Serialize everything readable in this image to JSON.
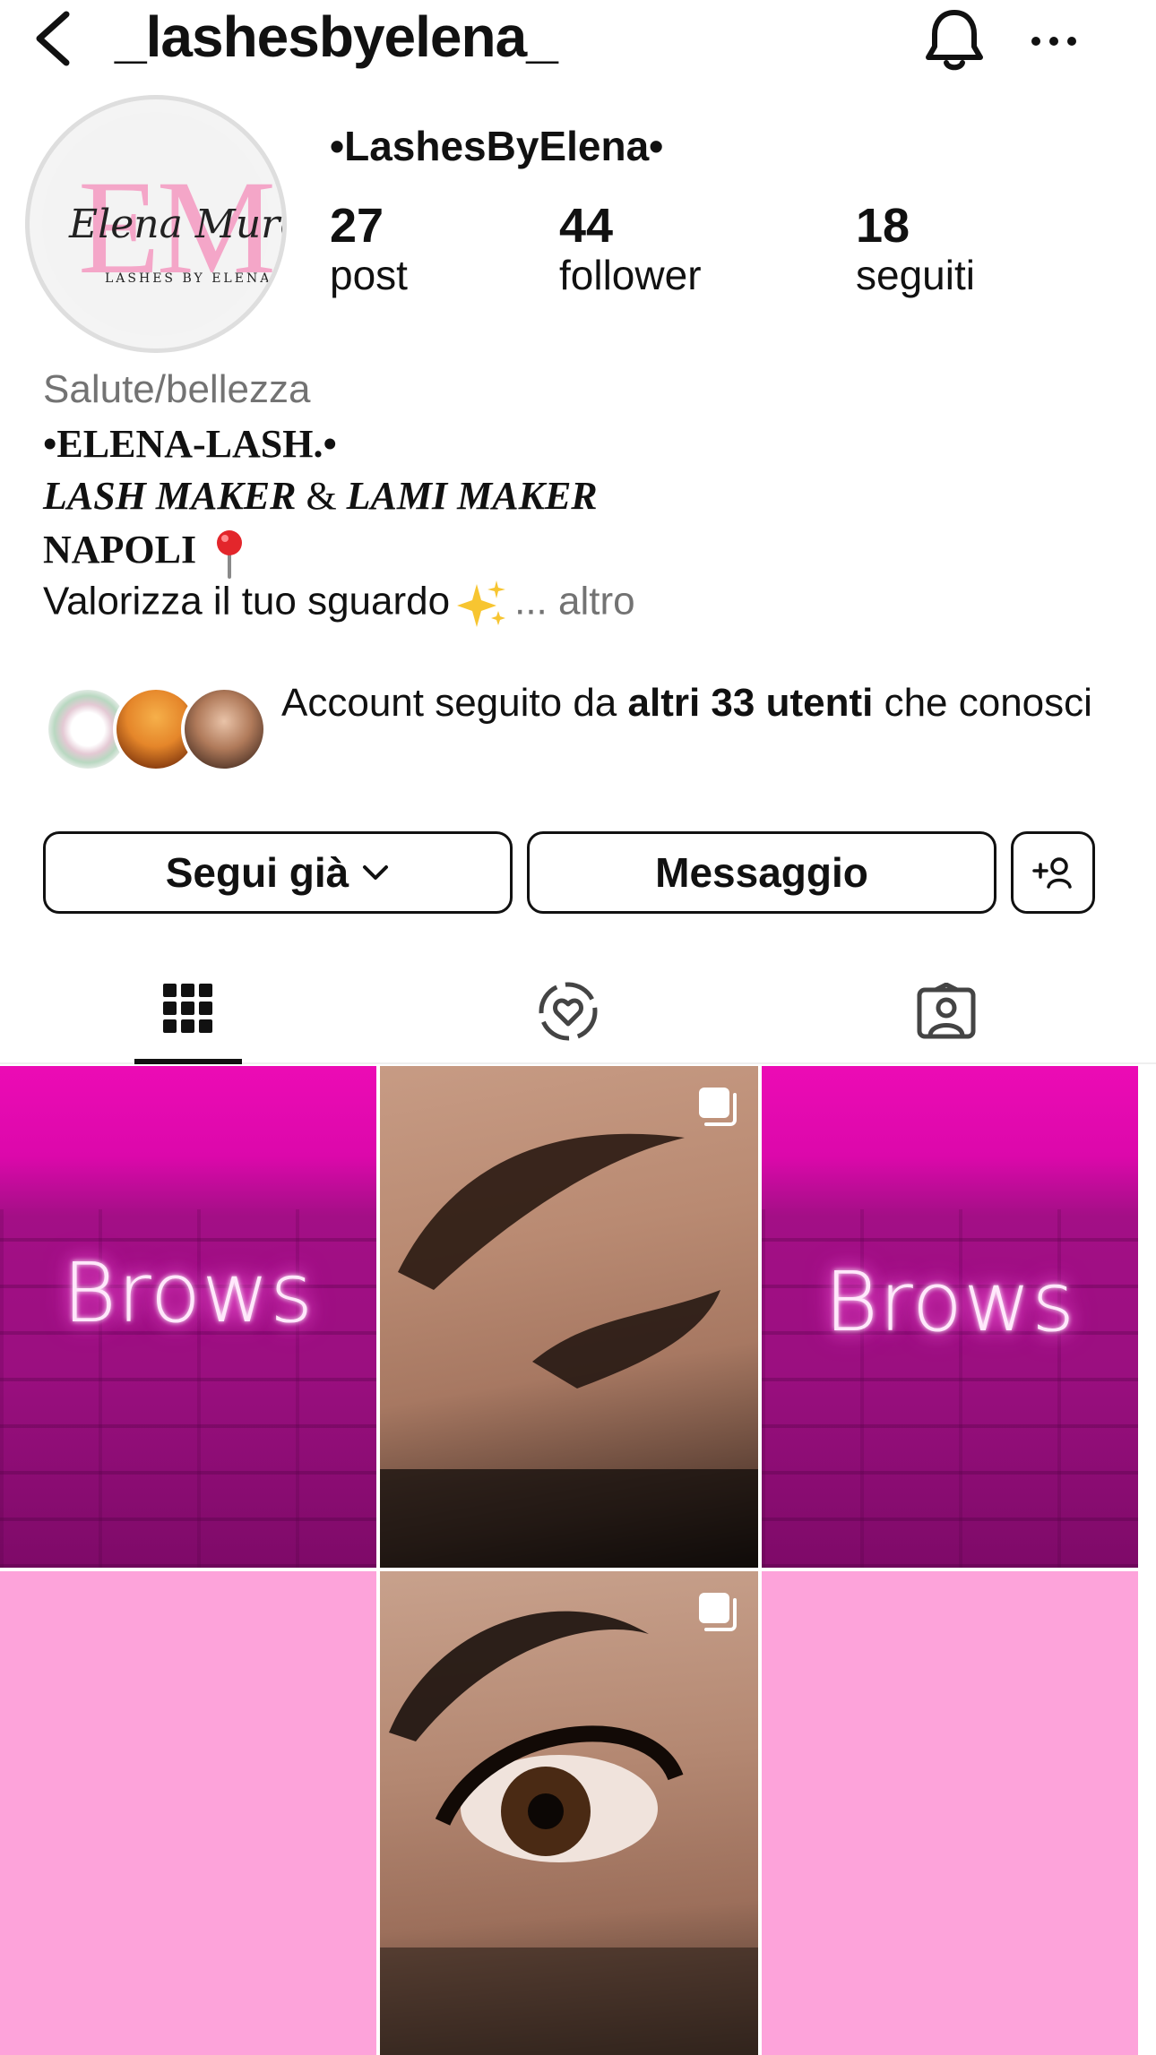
{
  "header": {
    "username": "_lashesbyelena_",
    "icons": [
      "back-icon",
      "bell-icon",
      "more-icon"
    ]
  },
  "profile": {
    "display_name": "•LashesByElena•",
    "avatar": {
      "monogram": "EM",
      "script": "Elena Murolo",
      "tagline": "LASHES BY ELENA"
    },
    "stats": [
      {
        "value": "27",
        "label": "post"
      },
      {
        "value": "44",
        "label": "follower"
      },
      {
        "value": "18",
        "label": "seguiti"
      }
    ],
    "category": "Salute/bellezza",
    "bio": {
      "line1": "•ELENA-LASH.•",
      "line2_part1": "LASH MAKER",
      "line2_amp": "&",
      "line2_part2": "LAMI MAKER",
      "line3": "NAPOLI",
      "line4": "Valorizza il tuo sguardo",
      "more_prefix": "...",
      "more_label": "altro"
    }
  },
  "mutual": {
    "prefix": "Account seguito da",
    "bold": "altri 33 utenti",
    "suffix": "che conosci"
  },
  "buttons": {
    "following": "Segui già",
    "message": "Messaggio"
  },
  "tabs": [
    "grid-icon",
    "reels-icon",
    "tagged-icon"
  ],
  "grid": {
    "posts": [
      {
        "type": "image",
        "text": "Brows"
      },
      {
        "type": "carousel",
        "text": ""
      },
      {
        "type": "image",
        "text": "Brows"
      },
      {
        "type": "image",
        "text": ""
      },
      {
        "type": "carousel",
        "text": ""
      },
      {
        "type": "image",
        "text": ""
      }
    ]
  },
  "colors": {
    "text": "#111111",
    "secondary": "#737373",
    "neon_pink": "#ec0bb5",
    "soft_pink": "#fda3da"
  }
}
